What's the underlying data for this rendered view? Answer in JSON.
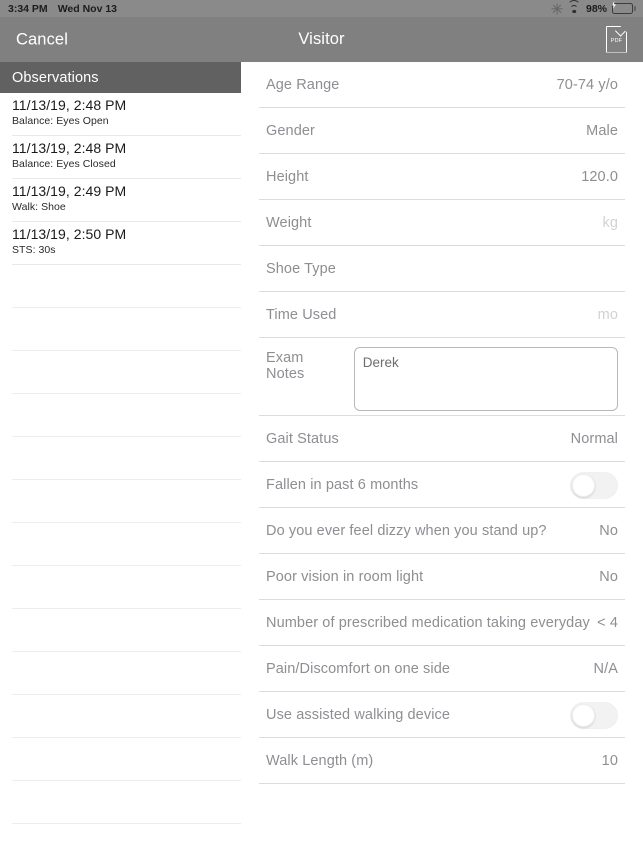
{
  "statusbar": {
    "time": "3:34 PM",
    "date": "Wed Nov 13",
    "battery_percent": "98%",
    "icons": [
      "sync-icon",
      "wifi-icon",
      "battery-charging-icon"
    ]
  },
  "navbar": {
    "cancel_label": "Cancel",
    "title": "Visitor",
    "pdf_label": "PDF",
    "pdf_icon": "pdf-document-icon"
  },
  "sidebar": {
    "header": "Observations",
    "observations": [
      {
        "timestamp": "11/13/19, 2:48 PM",
        "detail": "Balance: Eyes Open"
      },
      {
        "timestamp": "11/13/19, 2:48 PM",
        "detail": "Balance: Eyes Closed"
      },
      {
        "timestamp": "11/13/19, 2:49 PM",
        "detail": "Walk: Shoe"
      },
      {
        "timestamp": "11/13/19, 2:50 PM",
        "detail": "STS: 30s"
      }
    ],
    "empty_row_count": 13
  },
  "form": {
    "rows": [
      {
        "label": "Age Range",
        "value": "70-74 y/o",
        "type": "value",
        "dim": false
      },
      {
        "label": "Gender",
        "value": "Male",
        "type": "value",
        "dim": false
      },
      {
        "label": "Height",
        "value": "120.0",
        "type": "value",
        "dim": false
      },
      {
        "label": "Weight",
        "value": "kg",
        "type": "value",
        "dim": true
      },
      {
        "label": "Shoe Type",
        "value": "",
        "type": "value",
        "dim": false
      },
      {
        "label": "Time Used",
        "value": "mo",
        "type": "value",
        "dim": true
      }
    ],
    "notes": {
      "label": "Exam Notes",
      "value": "Derek",
      "placeholder": ""
    },
    "rows_after": [
      {
        "label": "Gait Status",
        "value": "Normal",
        "type": "value",
        "dim": false
      },
      {
        "label": "Fallen in past 6 months",
        "value": "",
        "type": "toggle",
        "on": false
      },
      {
        "label": "Do you ever feel dizzy when you stand up?",
        "value": "No",
        "type": "value",
        "dim": false
      },
      {
        "label": "Poor vision in room light",
        "value": "No",
        "type": "value",
        "dim": false
      },
      {
        "label": "Number of prescribed medication taking everyday",
        "value": "< 4",
        "type": "value",
        "dim": false
      },
      {
        "label": "Pain/Discomfort on one side",
        "value": "N/A",
        "type": "value",
        "dim": false
      },
      {
        "label": "Use assisted walking device",
        "value": "",
        "type": "toggle",
        "on": false
      },
      {
        "label": "Walk Length (m)",
        "value": "10",
        "type": "value",
        "dim": false
      }
    ]
  },
  "colors": {
    "navbar_bg": "#808080",
    "statusbar_bg": "#8a8a8a",
    "sidebar_header_bg": "#616161",
    "label_gray": "#8e8e93",
    "battery_green": "#3bd14e",
    "separator": "#dcdcdc"
  }
}
